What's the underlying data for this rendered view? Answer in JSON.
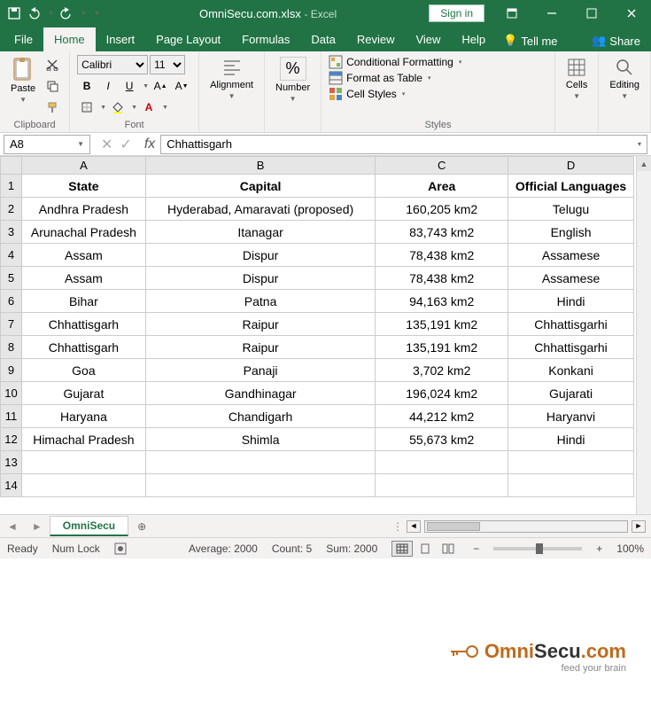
{
  "titlebar": {
    "filename": "OmniSecu.com.xlsx",
    "app": "Excel",
    "signin": "Sign in"
  },
  "tabs": [
    "File",
    "Home",
    "Insert",
    "Page Layout",
    "Formulas",
    "Data",
    "Review",
    "View",
    "Help"
  ],
  "active_tab": "Home",
  "tellme": "Tell me",
  "share": "Share",
  "ribbon": {
    "clipboard": {
      "label": "Clipboard",
      "paste": "Paste"
    },
    "font": {
      "label": "Font",
      "name": "Calibri",
      "size": "11"
    },
    "alignment": {
      "label": "Alignment"
    },
    "number": {
      "label": "Number"
    },
    "styles": {
      "label": "Styles",
      "conditional": "Conditional Formatting",
      "format_table": "Format as Table",
      "cell_styles": "Cell Styles"
    },
    "cells": {
      "label": "Cells"
    },
    "editing": {
      "label": "Editing"
    }
  },
  "namebox": "A8",
  "formula_value": "Chhattisgarh",
  "columns": [
    "A",
    "B",
    "C",
    "D"
  ],
  "row_count": 14,
  "headers": [
    "State",
    "Capital",
    "Area",
    "Official Languages"
  ],
  "rows": [
    [
      "Andhra Pradesh",
      "Hyderabad, Amaravati (proposed)",
      "160,205 km2",
      "Telugu"
    ],
    [
      "Arunachal Pradesh",
      "Itanagar",
      "83,743 km2",
      "English"
    ],
    [
      "Assam",
      "Dispur",
      "78,438 km2",
      "Assamese"
    ],
    [
      "Assam",
      "Dispur",
      "78,438 km2",
      "Assamese"
    ],
    [
      "Bihar",
      "Patna",
      "94,163 km2",
      "Hindi"
    ],
    [
      "Chhattisgarh",
      "Raipur",
      "135,191 km2",
      "Chhattisgarhi"
    ],
    [
      "Chhattisgarh",
      "Raipur",
      "135,191 km2",
      "Chhattisgarhi"
    ],
    [
      "Goa",
      "Panaji",
      "3,702 km2",
      "Konkani"
    ],
    [
      "Gujarat",
      "Gandhinagar",
      "196,024 km2",
      "Gujarati"
    ],
    [
      "Haryana",
      "Chandigarh",
      "44,212 km2",
      "Haryanvi"
    ],
    [
      "Himachal Pradesh",
      "Shimla",
      "55,673 km2",
      "Hindi"
    ]
  ],
  "sheet": {
    "name": "OmniSecu"
  },
  "statusbar": {
    "ready": "Ready",
    "numlock": "Num Lock",
    "average": "Average: 2000",
    "count": "Count: 5",
    "sum": "Sum: 2000",
    "zoom": "100%"
  },
  "watermark": {
    "main": "OmniSecu.com",
    "sub": "feed your brain"
  }
}
